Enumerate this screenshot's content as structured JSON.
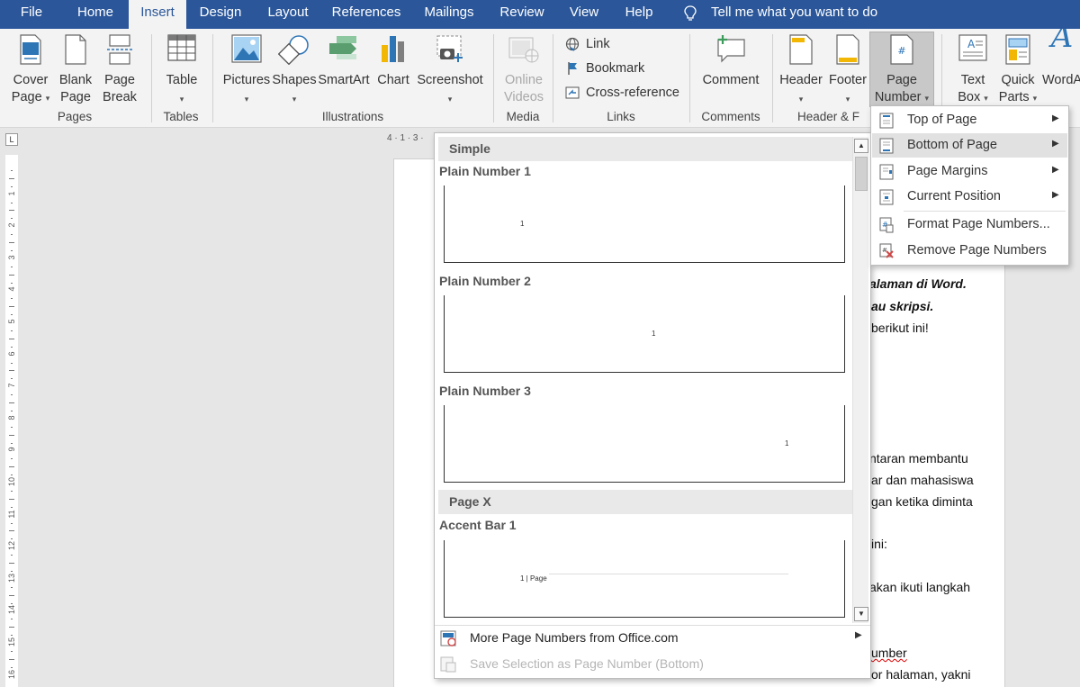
{
  "tabs": [
    {
      "label": "File",
      "active": false
    },
    {
      "label": "Home",
      "active": false
    },
    {
      "label": "Insert",
      "active": true
    },
    {
      "label": "Design",
      "active": false
    },
    {
      "label": "Layout",
      "active": false
    },
    {
      "label": "References",
      "active": false
    },
    {
      "label": "Mailings",
      "active": false
    },
    {
      "label": "Review",
      "active": false
    },
    {
      "label": "View",
      "active": false
    },
    {
      "label": "Help",
      "active": false
    }
  ],
  "tell_me": "Tell me what you want to do",
  "ribbon": {
    "pages": {
      "cover_1": "Cover",
      "cover_2": "Page",
      "blank_1": "Blank",
      "blank_2": "Page",
      "break_1": "Page",
      "break_2": "Break",
      "group": "Pages"
    },
    "tables": {
      "table": "Table",
      "group": "Tables"
    },
    "illustrations": {
      "pictures": "Pictures",
      "shapes": "Shapes",
      "smartart": "SmartArt",
      "chart": "Chart",
      "screenshot": "Screenshot",
      "group": "Illustrations"
    },
    "media": {
      "online_1": "Online",
      "online_2": "Videos",
      "group": "Media"
    },
    "links": {
      "link": "Link",
      "bookmark": "Bookmark",
      "cross_reference": "Cross-reference",
      "group": "Links"
    },
    "comments": {
      "comment": "Comment",
      "group": "Comments"
    },
    "header_footer": {
      "header": "Header",
      "footer": "Footer",
      "page_number_1": "Page",
      "page_number_2": "Number",
      "group": "Header & F"
    },
    "text": {
      "text_box_1": "Text",
      "text_box_2": "Box",
      "quick_parts_1": "Quick",
      "quick_parts_2": "Parts",
      "wordart": "WordA"
    }
  },
  "gallery": {
    "section_simple": "Simple",
    "plain1": "Plain Number 1",
    "plain2": "Plain Number 2",
    "plain3": "Plain Number 3",
    "section_pagex": "Page X",
    "accent1": "Accent Bar 1",
    "page_num": "1",
    "accent_text": "1 | Page",
    "more": "More Page Numbers from Office.com",
    "save_selection": "Save Selection as Page Number (Bottom)"
  },
  "submenu": {
    "top": "Top of Page",
    "bottom": "Bottom of Page",
    "margins": "Page Margins",
    "current": "Current Position",
    "format": "Format Page Numbers...",
    "remove": "Remove Page Numbers"
  },
  "ruler": {
    "corner": "L",
    "h_marks": "4 · 1 · 3 ·",
    "v_numbers": [
      "1",
      "2",
      "3",
      "4",
      "5",
      "6",
      "7",
      "8",
      "9",
      "10",
      "11",
      "12",
      "13",
      "14",
      "15",
      "16"
    ]
  },
  "document": {
    "l1": "alaman di Word.",
    "l2": "au skripsi.",
    "l3": "berikut ini!",
    "l4": "ntaran membantu",
    "l5": "ar dan mahasiswa",
    "l6": "gan ketika diminta",
    "l7": "ini:",
    "l8": "akan ikuti langkah",
    "l9": "umber",
    "l10": "or halaman, yakni"
  },
  "colors": {
    "tabbar": "#2b579a",
    "ribbon": "#f3f3f3",
    "accent": "#2b579a",
    "highlight": "#e1e1e1"
  }
}
